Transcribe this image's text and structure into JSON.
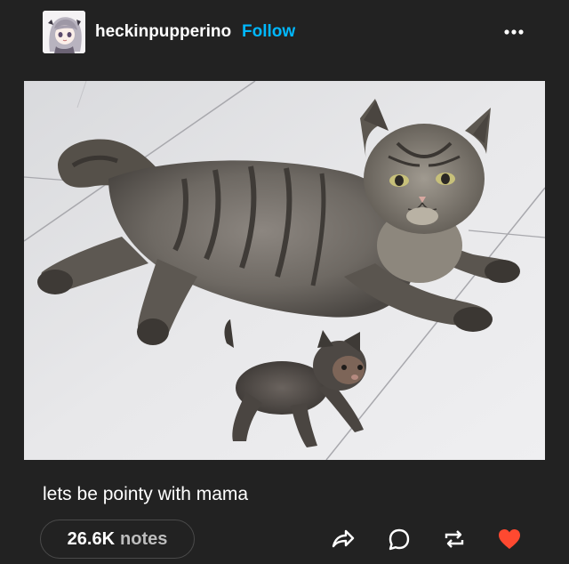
{
  "post": {
    "username": "heckinpupperino",
    "follow_label": "Follow",
    "caption": "lets be pointy with mama",
    "notes": {
      "count": "26.6K",
      "label": "notes"
    },
    "icons": {
      "more": "more-options-icon",
      "share": "share-icon",
      "reply": "reply-icon",
      "reblog": "reblog-icon",
      "like": "heart-icon"
    }
  },
  "colors": {
    "background": "#222222",
    "follow_accent": "#00b8ff",
    "like_accent": "#ff4930",
    "text": "#ffffff"
  }
}
